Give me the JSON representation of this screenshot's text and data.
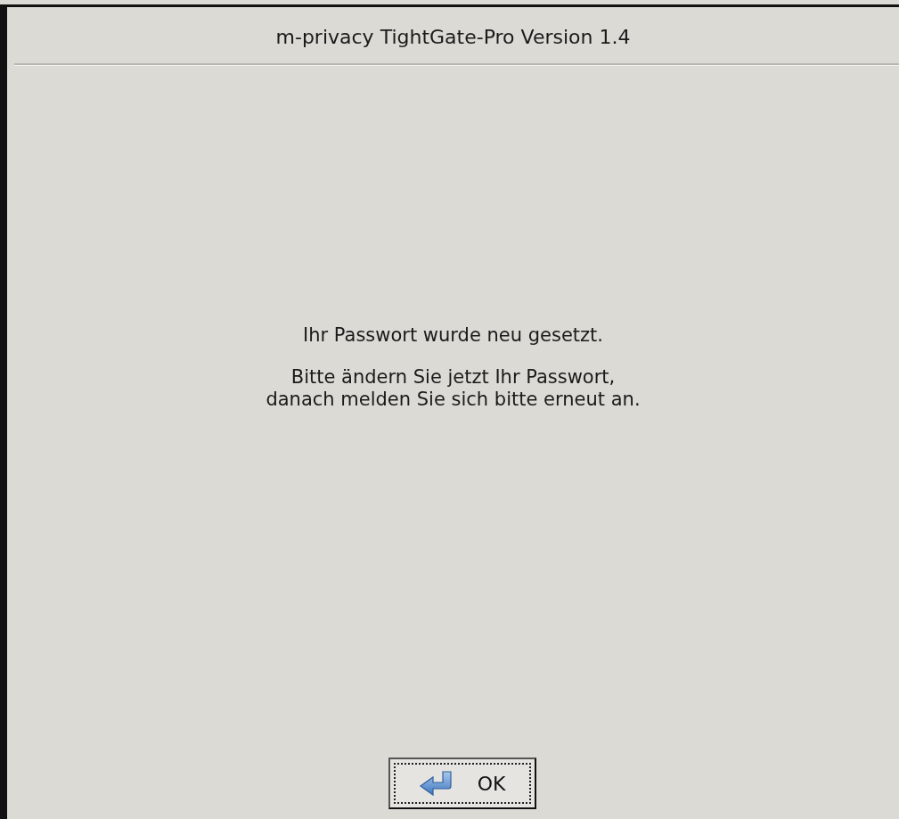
{
  "window": {
    "title": "m-privacy TightGate-Pro Version 1.4"
  },
  "message": [
    "Ihr Passwort wurde neu gesetzt.",
    "Bitte ändern Sie jetzt Ihr Passwort,\ndanach melden Sie sich bitte erneut an."
  ],
  "buttons": [
    {
      "label": "OK",
      "focused": true
    }
  ]
}
